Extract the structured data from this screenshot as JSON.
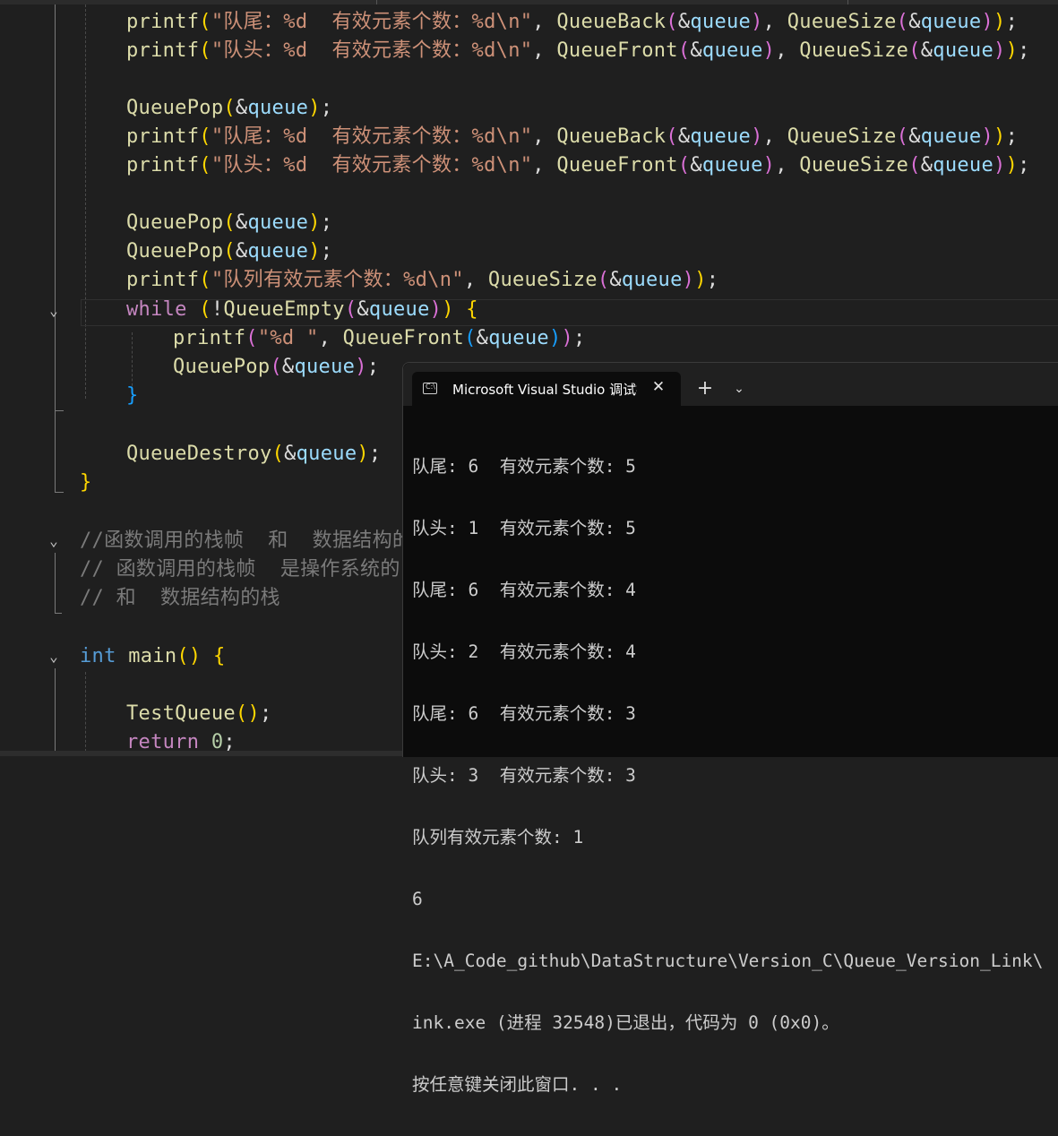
{
  "code": {
    "lines": [
      {
        "printf": "printf",
        "fmt": "\"队尾：%d  有效元素个数：%d\\n\"",
        "f1": "QueueBack",
        "f2": "QueueSize",
        "arg": "queue"
      },
      {
        "printf": "printf",
        "fmt": "\"队头：%d  有效元素个数：%d\\n\"",
        "f1": "QueueFront",
        "f2": "QueueSize",
        "arg": "queue"
      },
      {
        "pop": "QueuePop",
        "arg": "queue"
      },
      {
        "printf": "printf",
        "fmt": "\"队尾：%d  有效元素个数：%d\\n\"",
        "f1": "QueueBack",
        "f2": "QueueSize",
        "arg": "queue"
      },
      {
        "printf": "printf",
        "fmt": "\"队头：%d  有效元素个数：%d\\n\"",
        "f1": "QueueFront",
        "f2": "QueueSize",
        "arg": "queue"
      },
      {
        "pop": "QueuePop",
        "arg": "queue"
      },
      {
        "pop": "QueuePop",
        "arg": "queue"
      },
      {
        "printf": "printf",
        "fmt": "\"队列有效元素个数：%d\\n\"",
        "f1": "QueueSize",
        "arg": "queue"
      },
      {
        "kw": "while",
        "fn": "QueueEmpty",
        "arg": "queue"
      },
      {
        "printf": "printf",
        "fmt": "\"%d \"",
        "f1": "QueueFront",
        "arg": "queue"
      },
      {
        "pop": "QueuePop",
        "arg": "queue"
      },
      {
        "destroy": "QueueDestroy",
        "arg": "queue"
      },
      {
        "comment": "//函数调用的栈帧  和  数据结构的栈"
      },
      {
        "comment": "// 函数调用的栈帧  是操作系统的"
      },
      {
        "comment": "// 和  数据结构的栈"
      },
      {
        "type": "int",
        "fn": "main"
      },
      {
        "call": "TestQueue"
      },
      {
        "kw": "return",
        "num": "0"
      }
    ]
  },
  "console": {
    "title": "Microsoft Visual Studio 调试控制台",
    "icon": "terminal-icon",
    "close": "✕",
    "add": "+",
    "menu": "⌄",
    "output": [
      "队尾: 6  有效元素个数: 5",
      "队头: 1  有效元素个数: 5",
      "队尾: 6  有效元素个数: 4",
      "队头: 2  有效元素个数: 4",
      "队尾: 6  有效元素个数: 3",
      "队头: 3  有效元素个数: 3",
      "队列有效元素个数: 1",
      "6",
      "E:\\A_Code_github\\DataStructure\\Version_C\\Queue_Version_Link\\",
      "ink.exe (进程 32548)已退出，代码为 0 (0x0)。",
      "按任意键关闭此窗口. . ."
    ]
  }
}
